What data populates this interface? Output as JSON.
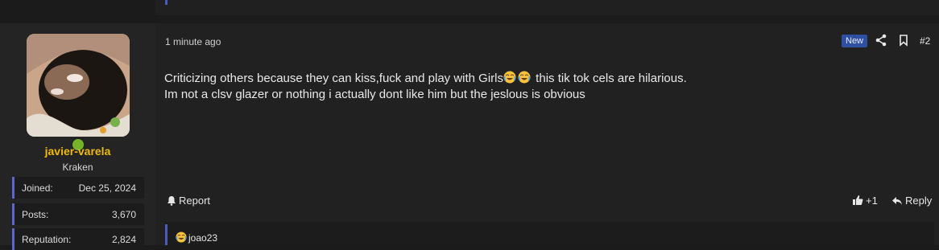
{
  "post": {
    "time": "1 minute ago",
    "badge": "New",
    "number": "#2",
    "content": {
      "line1_before": "Criticizing others because they can kiss,fuck and play with Girls",
      "line1_after": " this tik tok cels are hilarious.",
      "line2": "Im not a clsv glazer or nothing i actually dont like him but the jeslous is obvious"
    },
    "actions": {
      "report": "Report",
      "like_count": "+1",
      "reply": "Reply"
    },
    "reaction_user": "joao23"
  },
  "user": {
    "name": "javier-varela",
    "title": "Kraken",
    "stats": [
      {
        "key": "Joined:",
        "value": "Dec 25, 2024"
      },
      {
        "key": "Posts:",
        "value": "3,670"
      },
      {
        "key": "Reputation:",
        "value": "2,824"
      }
    ]
  },
  "colors": {
    "username": "#f0b90b",
    "accent": "#5e67c9",
    "online": "#77b32a",
    "badge": "#2f4fa3"
  },
  "icons": [
    "share-icon",
    "bookmark-icon",
    "bell-icon",
    "thumbs-up-icon",
    "reply-icon",
    "joy-emoji-icon"
  ]
}
